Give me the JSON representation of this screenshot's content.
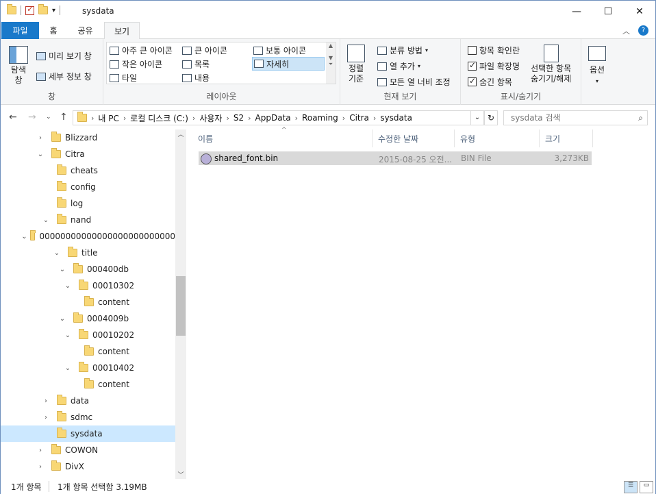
{
  "window": {
    "title": "sysdata"
  },
  "tabs": {
    "file": "파일",
    "home": "홈",
    "share": "공유",
    "view": "보기"
  },
  "ribbon": {
    "pane": {
      "nav_pane": "탐색\n창",
      "preview": "미리 보기 창",
      "details": "세부 정보 창",
      "label": "창"
    },
    "layout": {
      "items": [
        "아주 큰 아이콘",
        "큰 아이콘",
        "보통 아이콘",
        "작은 아이콘",
        "목록",
        "자세히",
        "타일",
        "내용"
      ],
      "label": "레이아웃"
    },
    "current_view": {
      "sort": "정렬\n기준",
      "group_by": "분류 방법",
      "add_columns": "열 추가",
      "size_all": "모든 열 너비 조정",
      "label": "현재 보기"
    },
    "show_hide": {
      "item_checkboxes": "항목 확인란",
      "file_ext": "파일 확장명",
      "hidden_items": "숨긴 항목",
      "hide_selected": "선택한 항목\n숨기기/해제",
      "label": "표시/숨기기"
    },
    "options": {
      "label": "옵션"
    }
  },
  "address": {
    "crumbs": [
      "내 PC",
      "로컬 디스크 (C:)",
      "사용자",
      "S2",
      "AppData",
      "Roaming",
      "Citra",
      "sysdata"
    ],
    "search_placeholder": "sysdata 검색"
  },
  "tree": [
    {
      "label": "Blizzard",
      "indent": 0,
      "toggle": "›"
    },
    {
      "label": "Citra",
      "indent": 0,
      "toggle": "⌄"
    },
    {
      "label": "cheats",
      "indent": 1,
      "toggle": ""
    },
    {
      "label": "config",
      "indent": 1,
      "toggle": ""
    },
    {
      "label": "log",
      "indent": 1,
      "toggle": ""
    },
    {
      "label": "nand",
      "indent": 1,
      "toggle": "⌄"
    },
    {
      "label": "00000000000000000000000000",
      "indent": 2,
      "toggle": "⌄"
    },
    {
      "label": "title",
      "indent": 3,
      "toggle": "⌄"
    },
    {
      "label": "000400db",
      "indent": 4,
      "toggle": "⌄"
    },
    {
      "label": "00010302",
      "indent": 5,
      "toggle": "⌄"
    },
    {
      "label": "content",
      "indent": 6,
      "toggle": ""
    },
    {
      "label": "0004009b",
      "indent": 4,
      "toggle": "⌄"
    },
    {
      "label": "00010202",
      "indent": 5,
      "toggle": "⌄"
    },
    {
      "label": "content",
      "indent": 6,
      "toggle": ""
    },
    {
      "label": "00010402",
      "indent": 5,
      "toggle": "⌄"
    },
    {
      "label": "content",
      "indent": 6,
      "toggle": ""
    },
    {
      "label": "data",
      "indent": 1,
      "toggle": "›"
    },
    {
      "label": "sdmc",
      "indent": 1,
      "toggle": "›"
    },
    {
      "label": "sysdata",
      "indent": 1,
      "toggle": "",
      "selected": true
    },
    {
      "label": "COWON",
      "indent": 0,
      "toggle": "›"
    },
    {
      "label": "DivX",
      "indent": 0,
      "toggle": "›"
    }
  ],
  "columns": {
    "name": "이름",
    "date": "수정한 날짜",
    "type": "유형",
    "size": "크기"
  },
  "files": [
    {
      "name": "shared_font.bin",
      "date": "2015-08-25 오전...",
      "type": "BIN File",
      "size": "3,273KB"
    }
  ],
  "status": {
    "count": "1개 항목",
    "selected": "1개 항목 선택함 3.19MB"
  }
}
